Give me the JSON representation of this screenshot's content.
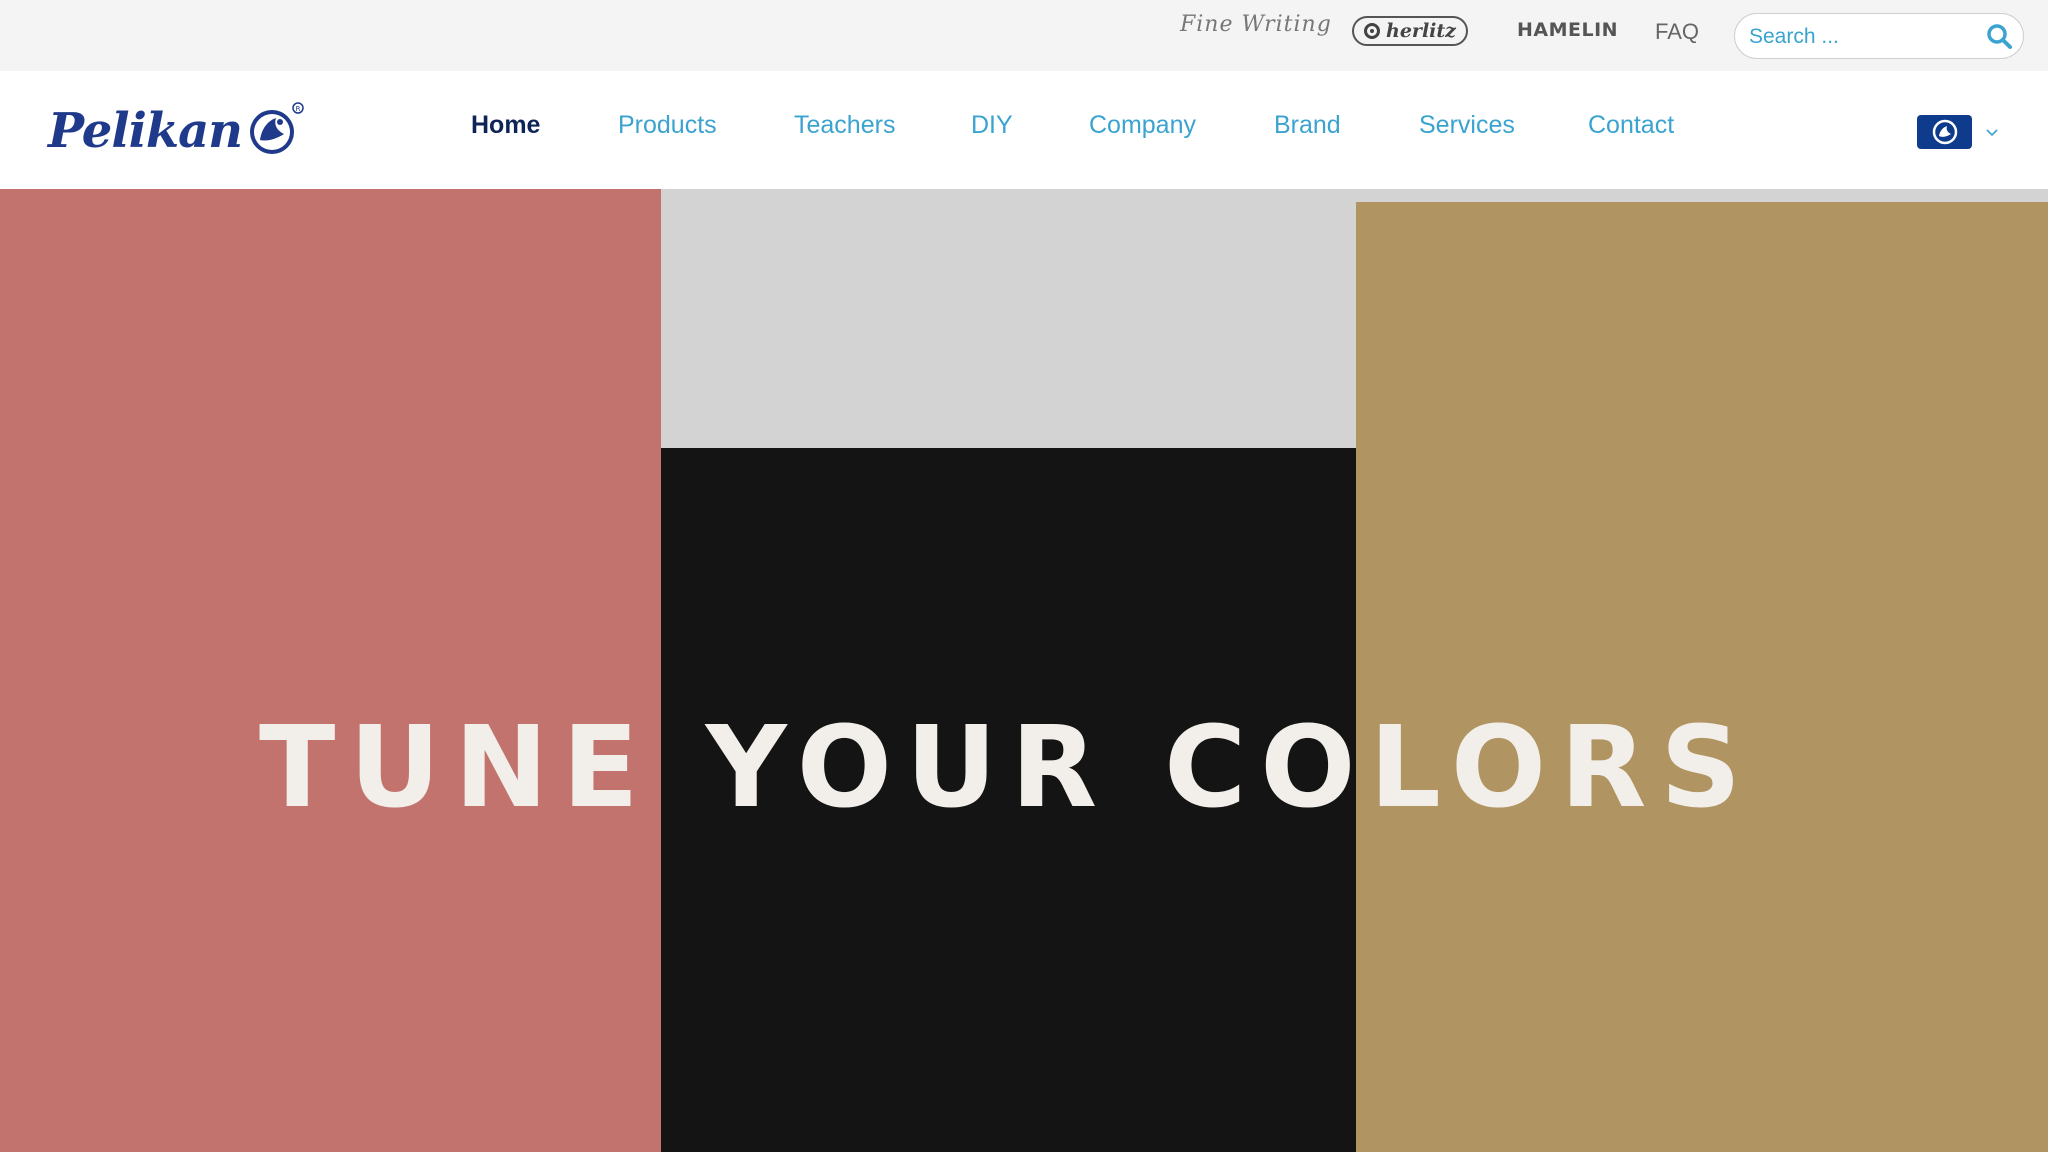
{
  "topbar": {
    "fine_writing_label": "Fine Writing",
    "herlitz_label": "herlitz",
    "hamelin_label": "HAMELIN",
    "faq_label": "FAQ",
    "search": {
      "placeholder": "Search ...",
      "icon": "search-icon"
    }
  },
  "navbar": {
    "logo_label": "Pelikan",
    "items": [
      {
        "label": "Home",
        "active": true
      },
      {
        "label": "Products"
      },
      {
        "label": "Teachers"
      },
      {
        "label": "DIY"
      },
      {
        "label": "Company"
      },
      {
        "label": "Brand"
      },
      {
        "label": "Services"
      },
      {
        "label": "Contact"
      }
    ],
    "language": {
      "icon": "pelikan-flag-icon",
      "dropdown_icon": "chevron-down-icon"
    }
  },
  "hero": {
    "title": "TUNE YOUR COLORS",
    "colors": {
      "pink": "#c2736e",
      "light_gray": "#d3d3d3",
      "black": "#141414",
      "gold": "#b09462"
    }
  },
  "theme": {
    "accent": "#3aa3cf",
    "active_nav": "#0f2456",
    "brand_blue": "#1f3a8a"
  }
}
